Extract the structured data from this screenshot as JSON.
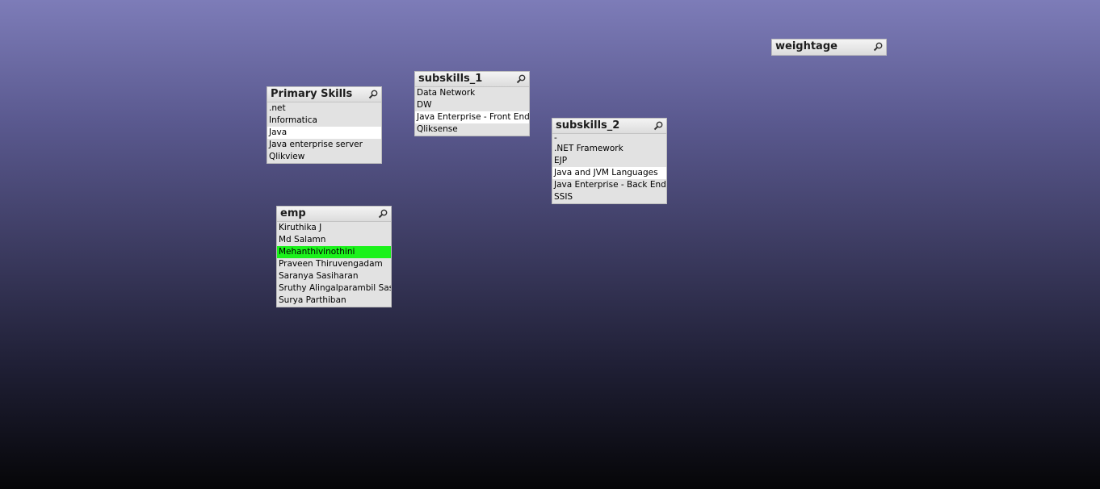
{
  "colors": {
    "selected": "#1bf21b",
    "possible": "#ffffff",
    "excluded": "#e2e2e2"
  },
  "listboxes": {
    "primary_skills": {
      "title": "Primary Skills",
      "items": [
        {
          "label": ".net",
          "state": "excluded"
        },
        {
          "label": "Informatica",
          "state": "excluded"
        },
        {
          "label": "Java",
          "state": "possible"
        },
        {
          "label": "Java enterprise server",
          "state": "excluded"
        },
        {
          "label": "Qlikview",
          "state": "excluded"
        }
      ]
    },
    "subskills_1": {
      "title": "subskills_1",
      "items": [
        {
          "label": "Data Network",
          "state": "excluded"
        },
        {
          "label": "DW",
          "state": "excluded"
        },
        {
          "label": "Java Enterprise - Front End",
          "state": "possible"
        },
        {
          "label": "Qliksense",
          "state": "excluded"
        }
      ]
    },
    "subskills_2": {
      "title": "subskills_2",
      "items": [
        {
          "label": "-",
          "state": "excluded"
        },
        {
          "label": ".NET Framework",
          "state": "excluded"
        },
        {
          "label": "EJP",
          "state": "excluded"
        },
        {
          "label": "Java and JVM Languages",
          "state": "possible"
        },
        {
          "label": "Java Enterprise - Back End",
          "state": "excluded"
        },
        {
          "label": "SSIS",
          "state": "excluded"
        }
      ]
    },
    "emp": {
      "title": "emp",
      "items": [
        {
          "label": "Kiruthika J",
          "state": "excluded"
        },
        {
          "label": "Md Salamn",
          "state": "excluded"
        },
        {
          "label": "Mehanthivinothini",
          "state": "selected"
        },
        {
          "label": "Praveen Thiruvengadam",
          "state": "excluded"
        },
        {
          "label": "Saranya Sasiharan",
          "state": "excluded"
        },
        {
          "label": "Sruthy Alingalparambil Sasi",
          "state": "excluded"
        },
        {
          "label": "Surya Parthiban",
          "state": "excluded"
        }
      ]
    },
    "weightage": {
      "title": "weightage",
      "items": []
    }
  }
}
